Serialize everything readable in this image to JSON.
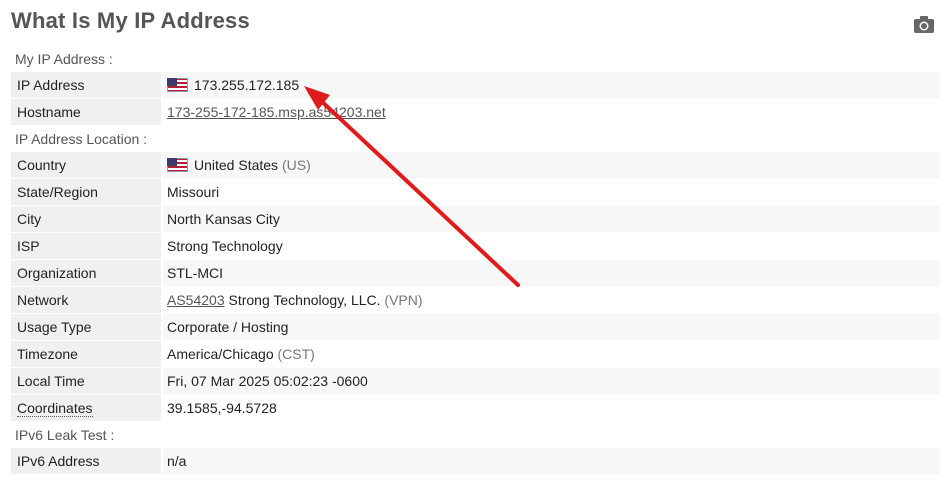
{
  "page": {
    "title": "What Is My IP Address"
  },
  "sections": {
    "my_ip": "My IP Address :",
    "location": "IP Address Location :",
    "ipv6": "IPv6 Leak Test :"
  },
  "my_ip": {
    "ip_label": "IP Address",
    "ip_value": "173.255.172.185",
    "hostname_label": "Hostname",
    "hostname_value": "173-255-172-185.msp.as54203.net"
  },
  "location": {
    "country_label": "Country",
    "country_value": "United States",
    "country_code": "(US)",
    "state_label": "State/Region",
    "state_value": "Missouri",
    "city_label": "City",
    "city_value": "North Kansas City",
    "isp_label": "ISP",
    "isp_value": "Strong Technology",
    "org_label": "Organization",
    "org_value": "STL-MCI",
    "network_label": "Network",
    "network_asn": "AS54203",
    "network_name": "Strong Technology, LLC.",
    "network_tag": "(VPN)",
    "usage_label": "Usage Type",
    "usage_value": "Corporate / Hosting",
    "tz_label": "Timezone",
    "tz_value": "America/Chicago",
    "tz_abbr": "(CST)",
    "localtime_label": "Local Time",
    "localtime_value": "Fri, 07 Mar 2025 05:02:23 -0600",
    "coords_label": "Coordinates",
    "coords_value": "39.1585,-94.5728"
  },
  "ipv6": {
    "label": "IPv6 Address",
    "value": "n/a"
  },
  "icons": {
    "camera": "camera-icon",
    "flag": "us-flag-icon",
    "annotation": "red-arrow"
  },
  "colors": {
    "arrow": "#e01b1b",
    "row_shade": "#f0f0f0",
    "title": "#555555"
  }
}
